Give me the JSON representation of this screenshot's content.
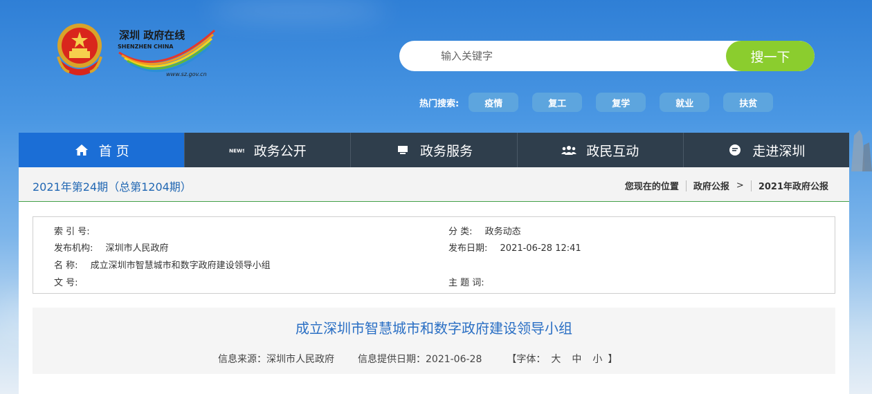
{
  "header": {
    "logo": {
      "brand_cn": "深圳 政府在线",
      "brand_en": "SHENZHEN CHINA",
      "url": "www.sz.gov.cn"
    },
    "search": {
      "placeholder": "输入关键字",
      "button_label": "搜一下"
    },
    "hot_search": {
      "label": "热门搜索:",
      "tags": [
        "疫情",
        "复工",
        "复学",
        "就业",
        "扶贫"
      ]
    }
  },
  "nav": {
    "items": [
      {
        "label": "首 页",
        "icon": "home-icon"
      },
      {
        "label": "政务公开",
        "icon": "news-icon"
      },
      {
        "label": "政务服务",
        "icon": "monitor-icon"
      },
      {
        "label": "政民互动",
        "icon": "people-icon"
      },
      {
        "label": "走进深圳",
        "icon": "chat-icon"
      }
    ]
  },
  "issue": {
    "title": "2021年第24期（总第1204期）"
  },
  "breadcrumb": {
    "label": "您现在的位置",
    "items": [
      "政府公报",
      "2021年政府公报"
    ],
    "separator": ">"
  },
  "meta": {
    "index_label": "索 引 号:",
    "index_value": "",
    "category_label": "分 类:",
    "category_value": "政务动态",
    "publisher_label": "发布机构:",
    "publisher_value": "深圳市人民政府",
    "pubdate_label": "发布日期:",
    "pubdate_value": "2021-06-28 12:41",
    "name_label": "名 称:",
    "name_value": "成立深圳市智慧城市和数字政府建设领导小组",
    "docno_label": "文 号:",
    "docno_value": "",
    "keywords_label": "主 题 词:",
    "keywords_value": ""
  },
  "article": {
    "title": "成立深圳市智慧城市和数字政府建设领导小组",
    "source": "信息来源：深圳市人民政府",
    "date": "信息提供日期：2021-06-28",
    "font_label_open": "【字体：",
    "font_large": "大",
    "font_medium": "中",
    "font_small": "小",
    "font_label_close": "】"
  },
  "colors": {
    "nav_active": "#1b6ed6",
    "nav_bg": "#2f3e4c",
    "search_button": "#8bcd2e",
    "hot_tag": "#5da5de",
    "title_blue": "#2a6fc4",
    "divider_green": "#43a047"
  }
}
